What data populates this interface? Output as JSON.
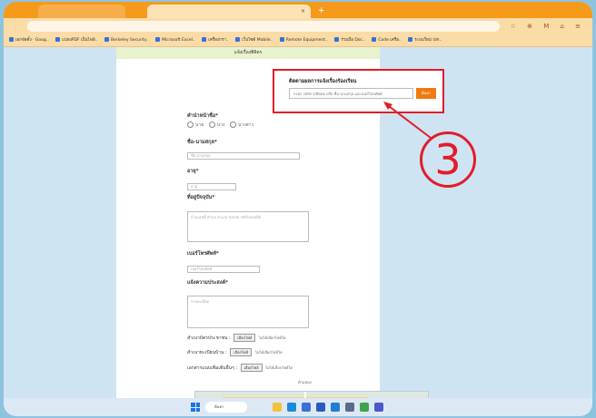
{
  "browser": {
    "tabs": [
      {
        "label": "",
        "active": false
      },
      {
        "label": "",
        "active": true
      }
    ],
    "new_tab_symbol": "+",
    "tab_close_symbol": "×",
    "toolbar_icons": "☆ ⊕ M ⌂ ≡",
    "bookmarks": [
      "เอกจัดตั้ง · Goog..",
      "แปลงPDF เป็นไฟล์..",
      "Berkeley Security..",
      "Microsoft Excel..",
      "เครื่องกรา..",
      "เว็บไซต์ Mobile..",
      "Remote Equipment..",
      "ร่วมมือ Doc..",
      "Code เครือ..",
      "ระบบใหม่ (ยก.."
    ]
  },
  "page": {
    "header_text": "แจ้งเรื่องพิจิตร",
    "search": {
      "title": "ติดตามผลการแจ้งเรื่องร้องเรียน",
      "placeholder": "กรอก รหัสการติดต่อ หรือ ชื่อ-นามสกุล และเบอร์โทรศัพท์",
      "button_label": "ค้นหา"
    },
    "form": {
      "prefix_label": "คำนำหน้าชื่อ*",
      "prefix_options": [
        "นาย",
        "นาง",
        "นางสาว"
      ],
      "name_label": "ชื่อ-นามสกุล*",
      "name_placeholder": "ชื่อ-นามสกุล",
      "age_label": "อายุ*",
      "age_placeholder": "อายุ",
      "address_label": "ที่อยู่ปัจจุบัน*",
      "address_placeholder": "บ้านเลขที่ ตำบล อำเภอ จังหวัด รหัสไปรษณีย์",
      "phone_label": "เบอร์โทรศัพท์*",
      "phone_placeholder": "เบอร์โทรศัพท์",
      "detail_label": "แจ้งความประสงค์*",
      "detail_placeholder": "รายละเอียด",
      "idcard_label": "สำเนาบัตรประชาชน :",
      "house_label": "สำเนาทะเบียนบ้าน :",
      "other_label": "เอกสารแนบเพิ่มเติมอื่นๆ :",
      "file_button": "เลือกไฟล์",
      "no_file_text": "ไม่ได้เลือกไฟล์ใด",
      "map_label": "ตำแหน่ง"
    }
  },
  "annotation": {
    "callout_number": "3",
    "color": "#e11d2a"
  },
  "taskbar": {
    "search_placeholder": "ค้นหา",
    "apps": [
      "explorer",
      "edge",
      "chrome",
      "store",
      "mail",
      "settings",
      "maps",
      "teams"
    ]
  },
  "colors": {
    "tab_bar": "#f59a1a",
    "search_button": "#f07a12",
    "header_band": "#e8f2cf"
  }
}
